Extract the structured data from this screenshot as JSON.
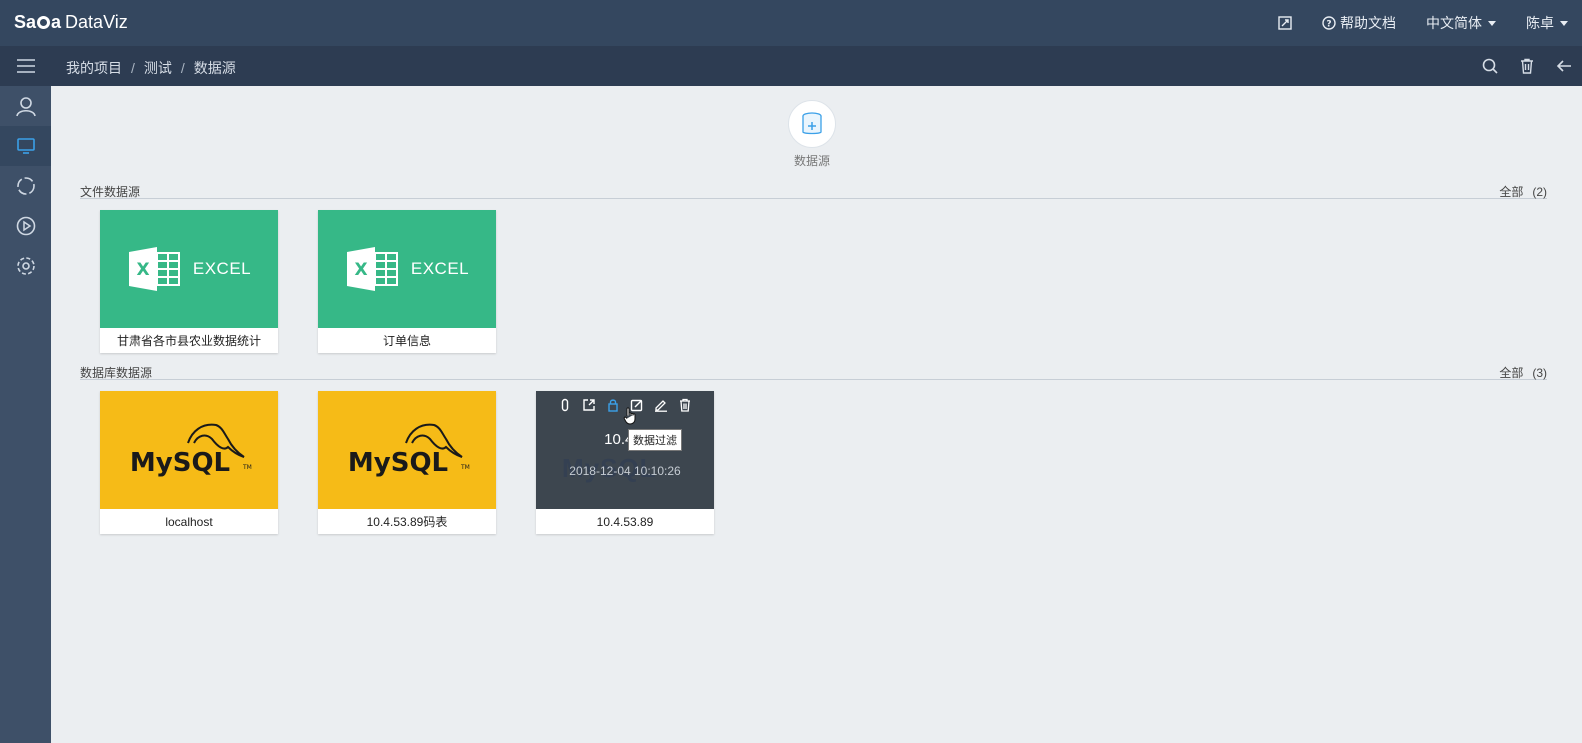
{
  "header": {
    "logo_brand": "Saga",
    "logo_product": "DataViz",
    "help_label": "帮助文档",
    "language_label": "中文简体",
    "user_label": "陈卓"
  },
  "breadcrumb": [
    "我的项目",
    "测试",
    "数据源"
  ],
  "add_datasource": {
    "label": "数据源"
  },
  "sections": {
    "file": {
      "title": "文件数据源",
      "all_label": "全部",
      "count": "(2)"
    },
    "database": {
      "title": "数据库数据源",
      "all_label": "全部",
      "count": "(3)"
    }
  },
  "file_cards": [
    {
      "type": "EXCEL",
      "caption": "甘肃省各市县农业数据统计"
    },
    {
      "type": "EXCEL",
      "caption": "订单信息"
    }
  ],
  "db_cards": [
    {
      "type": "MySQL",
      "caption": "localhost"
    },
    {
      "type": "MySQL",
      "caption": "10.4.53.89码表"
    },
    {
      "type": "MySQL",
      "caption": "10.4.53.89",
      "hover_title": "10.4.5",
      "hover_date": "2018-12-04 10:10:26",
      "tooltip": "数据过滤"
    }
  ],
  "icons": {
    "sidebar": [
      "menu-icon",
      "user-icon",
      "monitor-icon",
      "cycle-icon",
      "play-icon",
      "gear-icon"
    ],
    "toolbar": [
      "search-icon",
      "trash-icon",
      "back-arrow-icon"
    ],
    "card_actions": [
      "attach-icon",
      "share-icon",
      "lock-icon",
      "edit-square-icon",
      "pen-icon",
      "delete-icon"
    ]
  },
  "colors": {
    "excel": "#36b887",
    "mysql": "#f6bb17",
    "accent": "#3ba0e8",
    "header": "#34475f"
  }
}
